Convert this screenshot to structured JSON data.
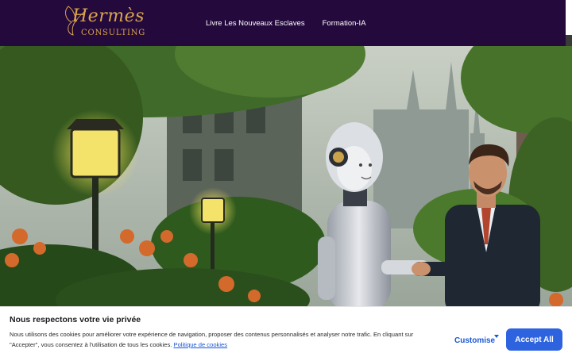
{
  "header": {
    "logo": {
      "script": "Hermès",
      "sub": "CONSULTING"
    },
    "nav": [
      {
        "label": "Livre Les Nouveaux Esclaves"
      },
      {
        "label": "Formation-IA"
      }
    ]
  },
  "hero": {
    "image": "robot-shaking-hands-with-businessman-in-garden-city"
  },
  "cookie": {
    "title": "Nous respectons votre vie privée",
    "text": "Nous utilisons des cookies pour améliorer votre expérience de navigation, proposer des contenus personnalisés et analyser notre trafic. En cliquant sur \"Accepter\", vous consentez à l'utilisation de tous les cookies.",
    "policy_link": "Politique de cookies",
    "customise_label": "Customise",
    "accept_label": "Accept All"
  },
  "colors": {
    "header_bg": "#24093d",
    "logo_gold": "#d9a54a",
    "accent_blue": "#2e63e0"
  }
}
